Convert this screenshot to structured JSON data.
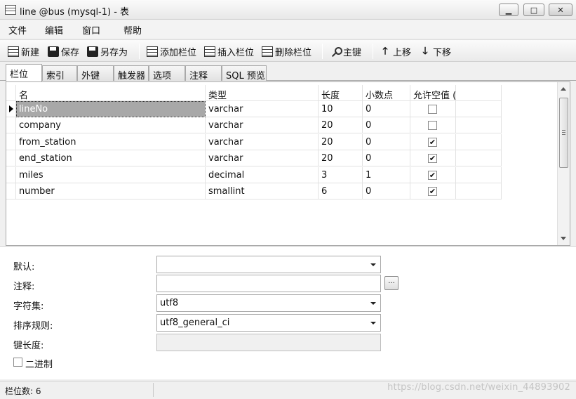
{
  "window": {
    "title": "line @bus (mysql-1) - 表",
    "minimize_symbol": "▁",
    "maximize_symbol": "□",
    "close_symbol": "✕"
  },
  "menu": [
    "文件",
    "编辑",
    "窗口",
    "帮助"
  ],
  "toolbar": {
    "new_label": "新建",
    "save_label": "保存",
    "save_as_label": "另存为",
    "add_field_label": "添加栏位",
    "insert_field_label": "插入栏位",
    "delete_field_label": "删除栏位",
    "primary_key_label": "主键",
    "move_up_label": "上移",
    "move_down_label": "下移",
    "up_arrow": "🡑",
    "down_arrow": "🡓"
  },
  "tabs": [
    "栏位",
    "索引",
    "外键",
    "触发器",
    "选项",
    "注释",
    "SQL 预览"
  ],
  "grid": {
    "columns": [
      "名",
      "类型",
      "长度",
      "小数点",
      "允许空值 ("
    ],
    "check_mark": "✔",
    "rows": [
      {
        "name": "lineNo",
        "type": "varchar",
        "length": "10",
        "decimals": "0",
        "nullable": false
      },
      {
        "name": "company",
        "type": "varchar",
        "length": "20",
        "decimals": "0",
        "nullable": false
      },
      {
        "name": "from_station",
        "type": "varchar",
        "length": "20",
        "decimals": "0",
        "nullable": true
      },
      {
        "name": "end_station",
        "type": "varchar",
        "length": "20",
        "decimals": "0",
        "nullable": true
      },
      {
        "name": "miles",
        "type": "decimal",
        "length": "3",
        "decimals": "1",
        "nullable": true
      },
      {
        "name": "number",
        "type": "smallint",
        "length": "6",
        "decimals": "0",
        "nullable": true
      }
    ]
  },
  "properties": {
    "default_label": "默认:",
    "default_value": "",
    "comment_label": "注释:",
    "comment_value": "",
    "ellipsis": "...",
    "charset_label": "字符集:",
    "charset_value": "utf8",
    "collation_label": "排序规则:",
    "collation_value": "utf8_general_ci",
    "key_length_label": "键长度:",
    "key_length_value": "",
    "binary_label": "二进制",
    "binary_checked": false
  },
  "status": {
    "field_count": "栏位数: 6"
  },
  "watermark": "https://blog.csdn.net/weixin_44893902"
}
